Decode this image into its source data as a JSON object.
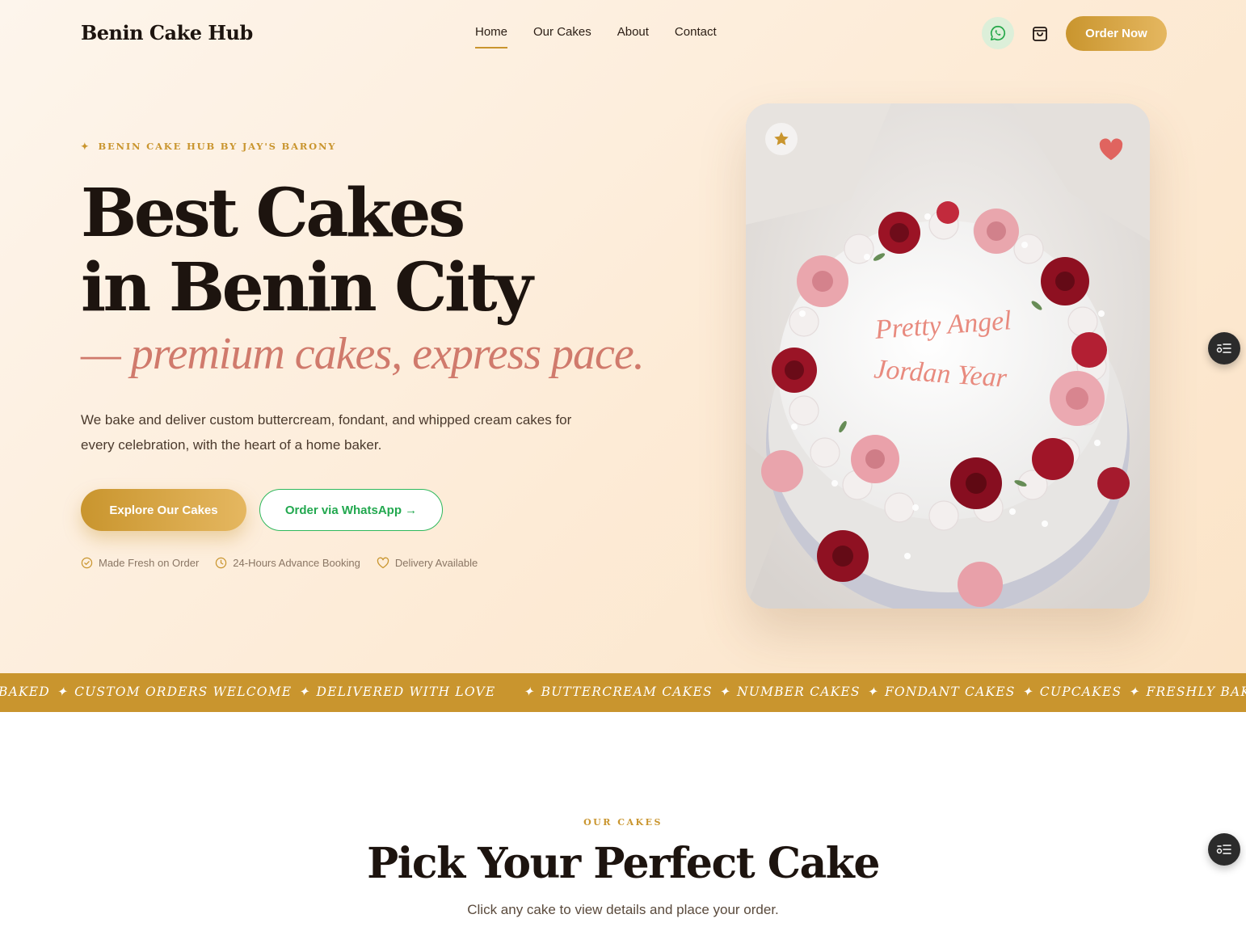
{
  "brand": "Benin Cake Hub",
  "nav": {
    "links": [
      {
        "label": "Home",
        "active": true
      },
      {
        "label": "Our Cakes",
        "active": false
      },
      {
        "label": "About",
        "active": false
      },
      {
        "label": "Contact",
        "active": false
      }
    ],
    "whatsapp_icon": "whatsapp-icon",
    "cart_icon": "shopping-bag-icon",
    "order_label": "Order Now"
  },
  "hero": {
    "eyebrow_star": "✦",
    "eyebrow": "BENIN CAKE HUB BY JAY'S BARONY",
    "title_line1": "Best Cakes",
    "title_line2": "in Benin City",
    "tagline": "— premium cakes, express pace.",
    "lead": "We bake and deliver custom buttercream, fondant, and whipped cream cakes for every celebration, with the heart of a home baker.",
    "primary_cta": "Explore Our Cakes",
    "secondary_cta": "Order via WhatsApp →",
    "features": [
      {
        "icon": "check-circle-icon",
        "label": "Made Fresh on Order"
      },
      {
        "icon": "clock-icon",
        "label": "24-Hours Advance Booking"
      },
      {
        "icon": "heart-icon",
        "label": "Delivery Available"
      }
    ],
    "card": {
      "image": "cake-photo",
      "cake_text_line1": "Pretty Angel",
      "cake_text_line2": "Jordan Year",
      "badge_icon": "star-icon",
      "favorite_icon": "heart-icon"
    }
  },
  "marquee": {
    "separator": "✦",
    "items_a": [
      "BAKED",
      "CUSTOM ORDERS WELCOME",
      "DELIVERED WITH LOVE"
    ],
    "items_b": [
      "BUTTERCREAM CAKES",
      "NUMBER CAKES",
      "FONDANT CAKES",
      "CUPCAKES",
      "FRESHLY BAKED",
      "CUSTOM ORDERS WELCOME"
    ]
  },
  "section": {
    "eyebrow": "OUR CAKES",
    "title": "Pick Your Perfect Cake",
    "subtitle": "Click any cake to view details and place your order."
  },
  "floating": {
    "icon": "toggle-list-icon"
  },
  "colors": {
    "accent": "#c9952e",
    "rose": "#d07a6c",
    "whatsapp": "#2eb85c",
    "dark": "#1d140f"
  }
}
